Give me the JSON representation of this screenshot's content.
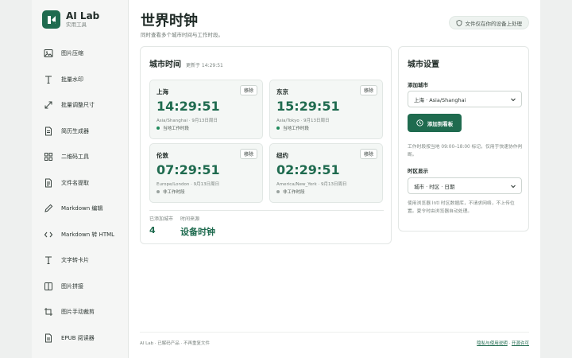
{
  "app": {
    "title": "AI Lab",
    "subtitle": "实用工具"
  },
  "nav": [
    {
      "label": "图片压缩",
      "icon": "image-icon"
    },
    {
      "label": "批量水印",
      "icon": "text-icon"
    },
    {
      "label": "批量调整尺寸",
      "icon": "resize-icon"
    },
    {
      "label": "简历生成器",
      "icon": "document-icon"
    },
    {
      "label": "二维码工具",
      "icon": "qr-icon"
    },
    {
      "label": "文件名提取",
      "icon": "file-icon"
    },
    {
      "label": "Markdown 编辑",
      "icon": "edit-icon"
    },
    {
      "label": "Markdown 转 HTML",
      "icon": "code-icon"
    },
    {
      "label": "文字转卡片",
      "icon": "text-icon"
    },
    {
      "label": "图片拼接",
      "icon": "columns-icon"
    },
    {
      "label": "图片手动裁剪",
      "icon": "crop-icon"
    },
    {
      "label": "EPUB 阅读器",
      "icon": "book-icon"
    }
  ],
  "header": {
    "title": "世界时钟",
    "subtitle": "同时查看多个城市时间与工作时段。",
    "badge": "文件仅在你的设备上处理"
  },
  "cities_panel": {
    "title": "城市时间",
    "updated": "更新于 14:29:51",
    "remove_label": "移除",
    "cities": [
      {
        "name": "上海",
        "time": "14:29:51",
        "meta": "Asia/Shanghai · 9月13日周日",
        "status": "当地工作时段",
        "working": true
      },
      {
        "name": "东京",
        "time": "15:29:51",
        "meta": "Asia/Tokyo · 9月13日周日",
        "status": "当地工作时段",
        "working": true
      },
      {
        "name": "伦敦",
        "time": "07:29:51",
        "meta": "Europe/London · 9月13日周日",
        "status": "非工作时段",
        "working": false
      },
      {
        "name": "纽约",
        "time": "02:29:51",
        "meta": "America/New_York · 9月13日周日",
        "status": "非工作时段",
        "working": false
      }
    ],
    "stats": {
      "count_label": "已添加城市",
      "count_value": "4",
      "source_label": "时间来源",
      "source_value": "设备时钟"
    }
  },
  "settings": {
    "title": "城市设置",
    "add_label": "添加城市",
    "add_selected": "上海 · Asia/Shanghai",
    "add_button": "添加到看板",
    "work_note": "工作时段按当地 09:00–18:00 标记，仅用于快速协作判断。",
    "display_label": "时区显示",
    "display_selected": "城市 · 时区 · 日期",
    "privacy_note": "使用浏览器 Intl 时区数据库，不请求网络，不上传位置。夏令时由浏览器自动处理。"
  },
  "footer": {
    "left": "AI Lab · 已解码产品 · 不再重复文件",
    "link_privacy": "隐私与使用说明",
    "separator": " · ",
    "link_open": "开源许可"
  },
  "colors": {
    "accent": "#1f6b4f",
    "working_dot": "#1f8a5c",
    "off_dot": "#9aa39f"
  }
}
